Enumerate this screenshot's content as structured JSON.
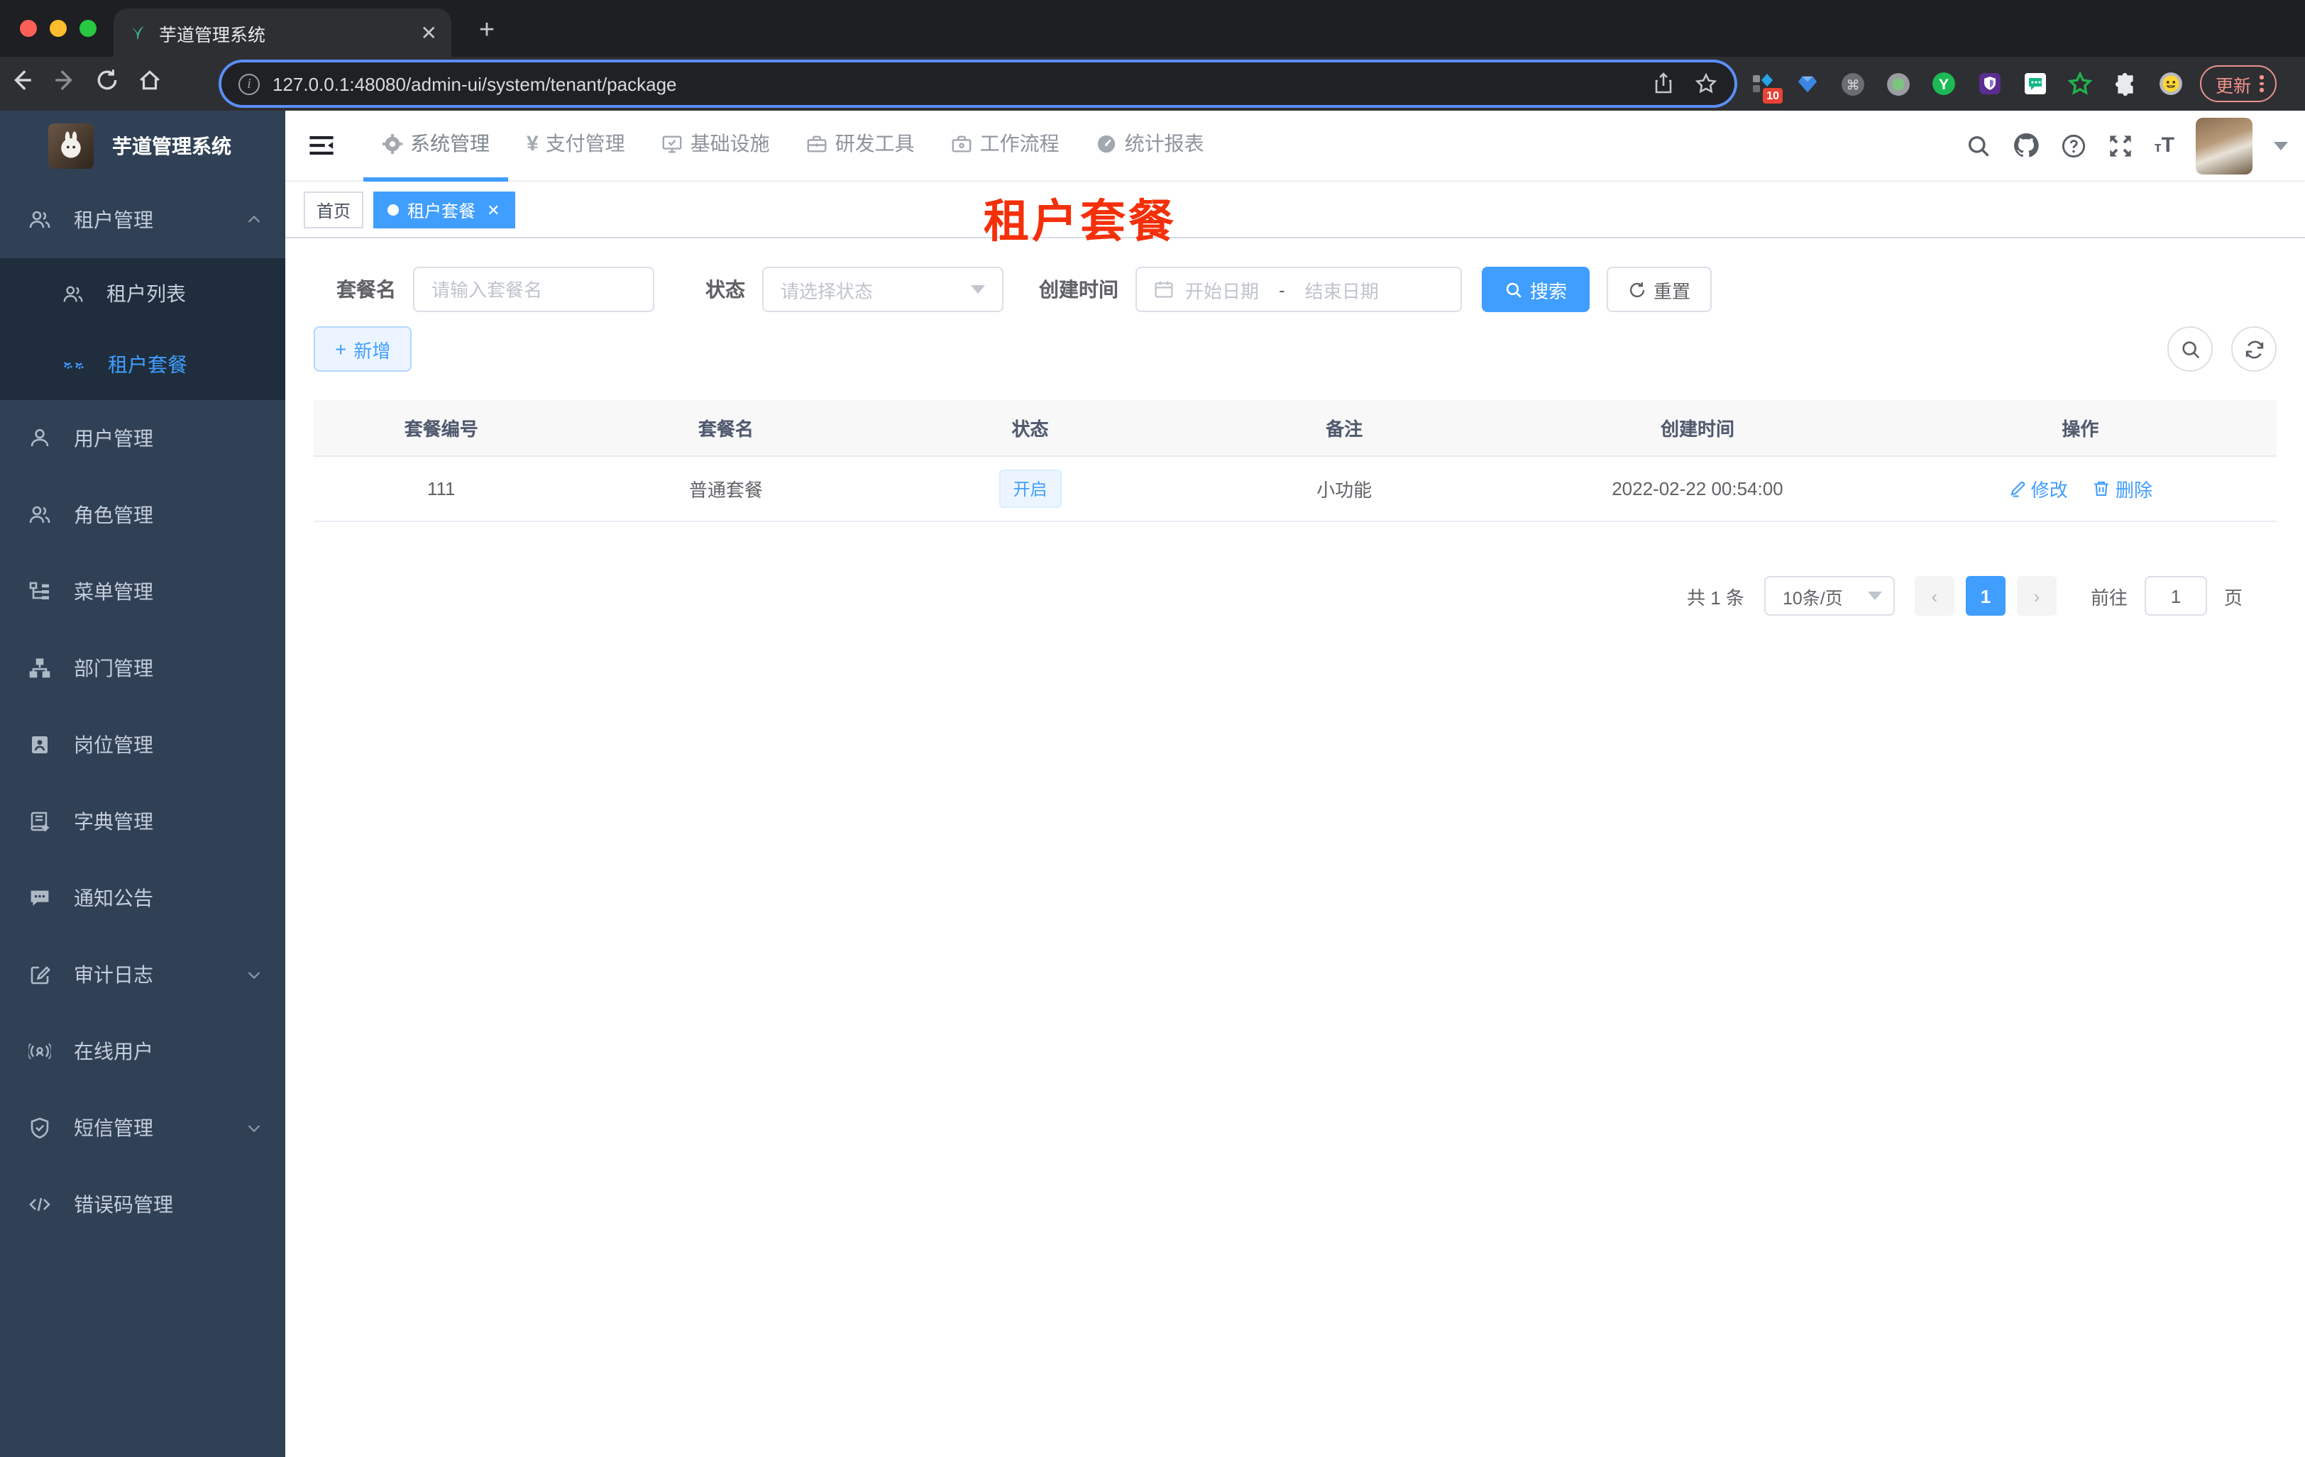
{
  "colors": {
    "accent": "#409eff",
    "sidebar_bg": "#304156",
    "submenu_bg": "#1f2d3d",
    "annotation_red": "#f4300a",
    "status_tag_bg": "#ecf5ff",
    "traffic_lights": [
      "#ff5f57",
      "#febc2e",
      "#28c840"
    ]
  },
  "browser": {
    "tab_title": "芋道管理系统",
    "url": "127.0.0.1:48080/admin-ui/system/tenant/package",
    "extensions_badge": "10",
    "update_label": "更新"
  },
  "sidebar": {
    "logo_title": "芋道管理系统",
    "items": [
      {
        "label": "租户管理",
        "expanded": true,
        "children": [
          {
            "label": "租户列表"
          },
          {
            "label": "租户套餐",
            "active": true
          }
        ]
      },
      {
        "label": "用户管理"
      },
      {
        "label": "角色管理"
      },
      {
        "label": "菜单管理"
      },
      {
        "label": "部门管理"
      },
      {
        "label": "岗位管理"
      },
      {
        "label": "字典管理"
      },
      {
        "label": "通知公告"
      },
      {
        "label": "审计日志",
        "has_children": true
      },
      {
        "label": "在线用户"
      },
      {
        "label": "短信管理",
        "has_children": true
      },
      {
        "label": "错误码管理"
      }
    ]
  },
  "header": {
    "nav": [
      {
        "label": "系统管理",
        "active": true
      },
      {
        "label": "支付管理"
      },
      {
        "label": "基础设施"
      },
      {
        "label": "研发工具"
      },
      {
        "label": "工作流程"
      },
      {
        "label": "统计报表"
      }
    ],
    "yen_glyph": "¥",
    "font_size_glyph": "тT"
  },
  "tags": {
    "home": "首页",
    "active_tag": "租户套餐"
  },
  "annotation": "租户套餐",
  "filters": {
    "name_label": "套餐名",
    "name_placeholder": "请输入套餐名",
    "status_label": "状态",
    "status_placeholder": "请选择状态",
    "date_label": "创建时间",
    "date_start_placeholder": "开始日期",
    "date_separator": "-",
    "date_end_placeholder": "结束日期",
    "search_label": "搜索",
    "reset_label": "重置"
  },
  "toolbar": {
    "add_label": "新增"
  },
  "table": {
    "headers": [
      "套餐编号",
      "套餐名",
      "状态",
      "备注",
      "创建时间",
      "操作"
    ],
    "rows": [
      {
        "id": "111",
        "name": "普通套餐",
        "status": "开启",
        "remark": "小功能",
        "created": "2022-02-22 00:54:00",
        "edit_label": "修改",
        "delete_label": "删除"
      }
    ]
  },
  "pagination": {
    "total": "共 1 条",
    "page_size": "10条/页",
    "prev_glyph": "‹",
    "next_glyph": "›",
    "current_page": "1",
    "goto_label": "前往",
    "goto_value": "1",
    "unit_label": "页"
  }
}
